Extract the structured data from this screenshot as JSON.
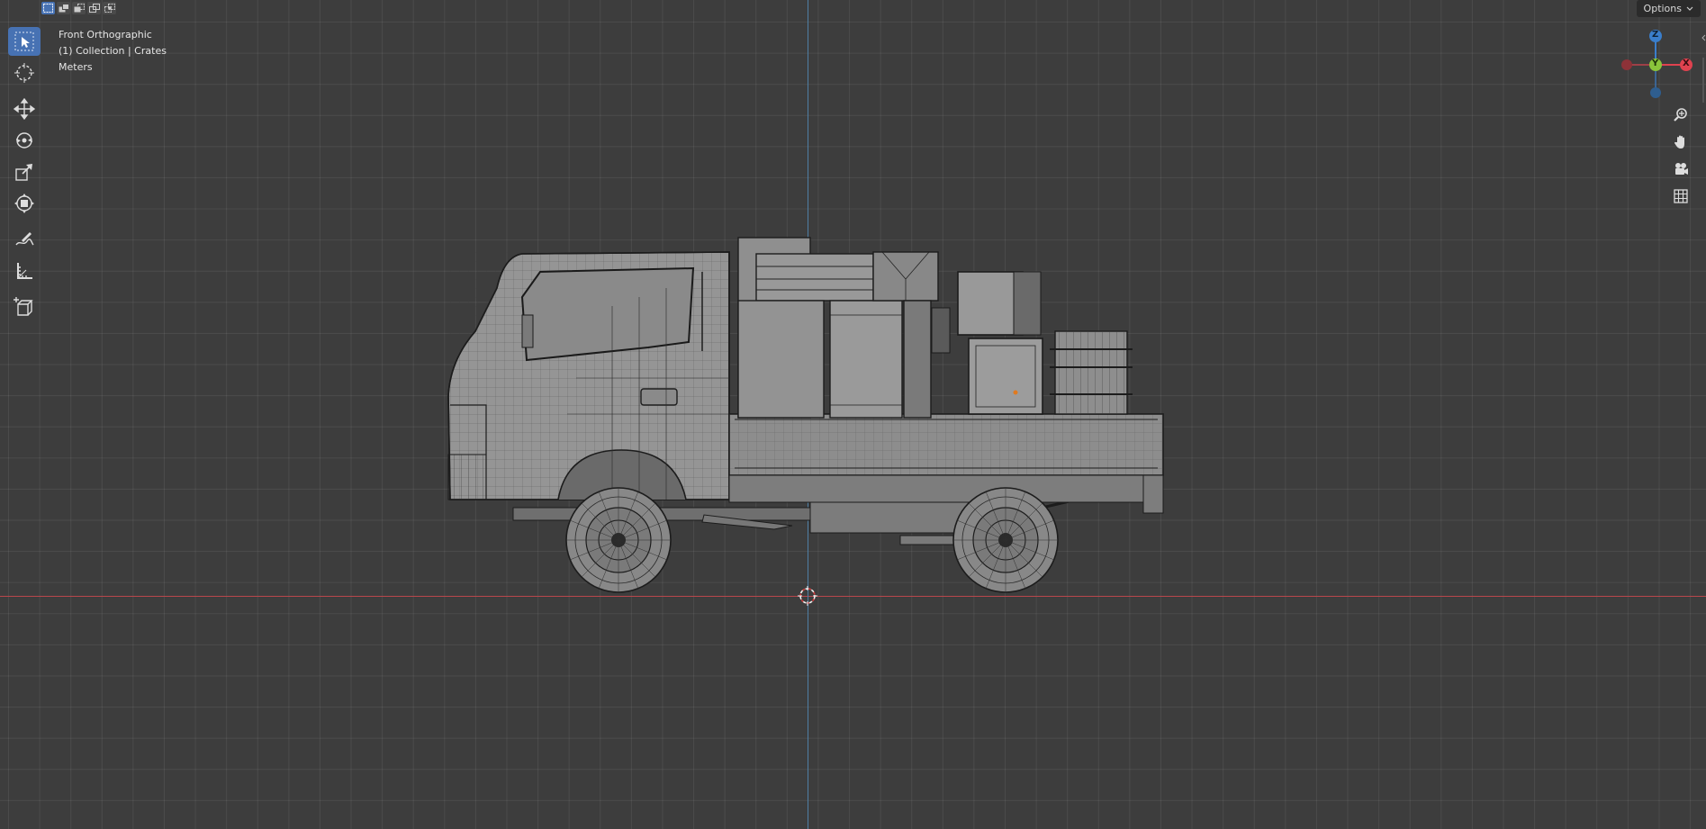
{
  "viewport": {
    "view_name": "Front Orthographic",
    "collection_info": "(1) Collection | Crates",
    "units": "Meters"
  },
  "header": {
    "options_label": "Options",
    "select_modes": [
      "select-new-icon",
      "select-extend-icon",
      "select-subtract-icon",
      "select-difference-icon",
      "select-intersect-icon"
    ]
  },
  "toolbar": {
    "tools": [
      "select-box-icon",
      "cursor-icon",
      "move-icon",
      "rotate-icon",
      "scale-icon",
      "transform-icon",
      "annotate-icon",
      "measure-icon",
      "add-cube-icon"
    ],
    "active_tool": "select-box-icon"
  },
  "gizmo": {
    "z_label": "Z",
    "y_label": "Y",
    "x_label": "X",
    "colors": {
      "x": "#e0424f",
      "y": "#8ac43b",
      "z": "#3a7ecb"
    }
  },
  "nav": [
    "zoom-icon",
    "pan-hand-icon",
    "camera-icon",
    "grid-toggle-icon"
  ],
  "colors": {
    "background": "#3d3d3d",
    "grid": "#4a4a4a",
    "x_axis": "#b8474b",
    "z_axis": "#4f7fa5",
    "active": "#4772b3",
    "wire": "#1c1c1c",
    "mesh": "#8f8f8f"
  }
}
